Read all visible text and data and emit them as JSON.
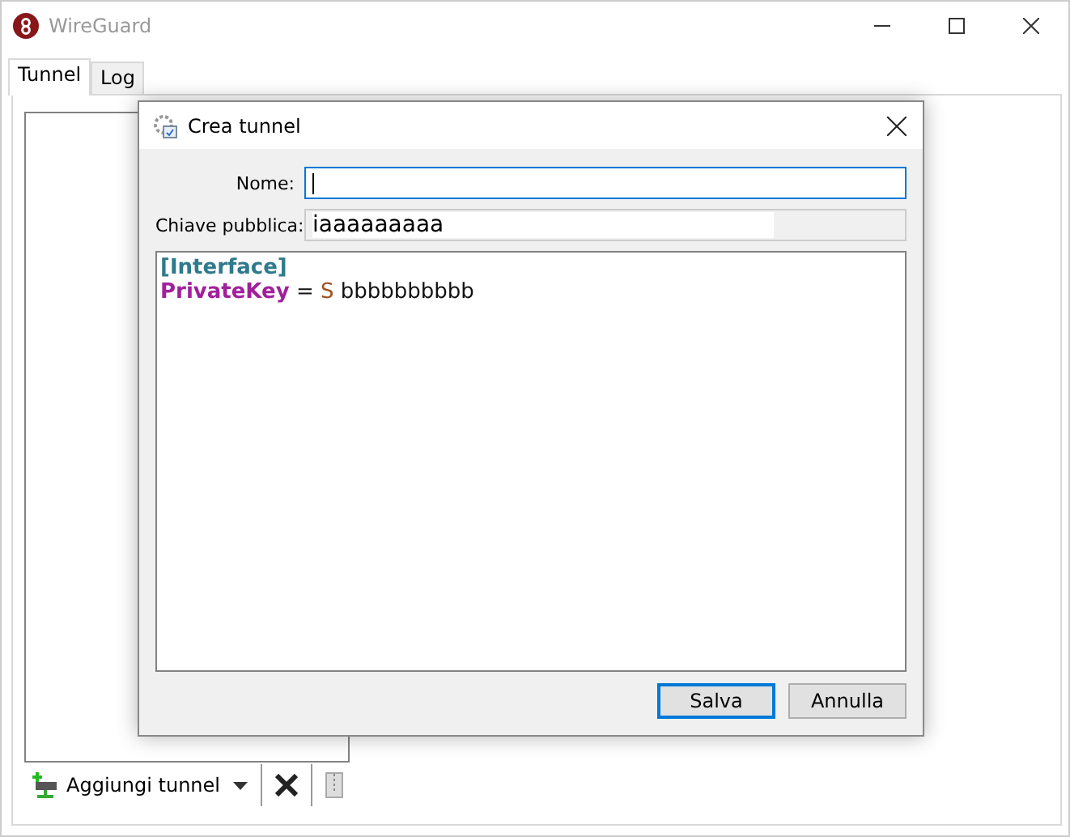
{
  "window": {
    "title": "WireGuard"
  },
  "tabs": [
    {
      "label": "Tunnel",
      "selected": true
    },
    {
      "label": "Log",
      "selected": false
    }
  ],
  "toolbar": {
    "add_button": "Aggiungi tunnel"
  },
  "dialog": {
    "title": "Crea tunnel",
    "fields": [
      {
        "label": "Nome:",
        "readonly": false,
        "focused": true
      },
      {
        "label": "Chiave pubblica:",
        "value": "iaaaaaaaaa",
        "readonly": true,
        "focused": false
      }
    ],
    "editor": [
      [
        {
          "kind": "section",
          "text": "[Interface]"
        }
      ],
      [
        {
          "kind": "key",
          "text": "PrivateKey"
        },
        {
          "kind": "plain",
          "text": "="
        },
        {
          "kind": "value-start",
          "text": "S"
        },
        {
          "kind": "plain",
          "text": "bbbbbbbbbb"
        }
      ]
    ],
    "buttons": [
      {
        "label": "Salva",
        "default": true
      },
      {
        "label": "Annulla",
        "default": false
      }
    ]
  }
}
